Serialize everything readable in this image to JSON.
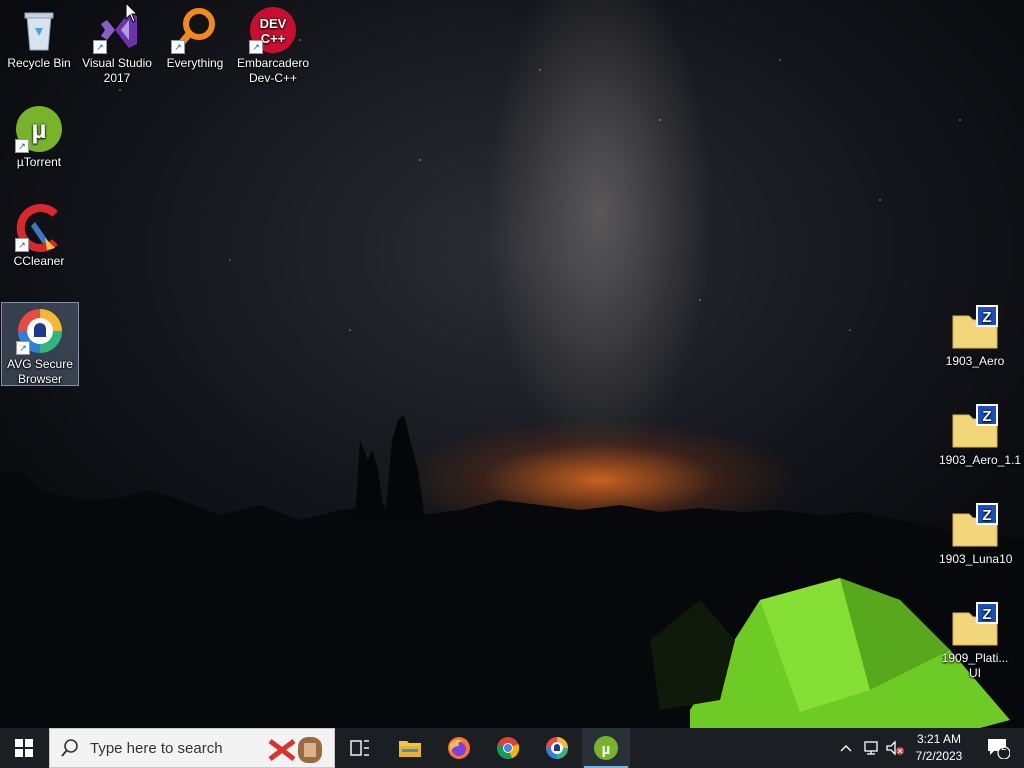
{
  "desktop": {
    "icons": [
      {
        "label": "Recycle Bin",
        "icon": "recycle-bin-icon"
      },
      {
        "label": "Visual Studio 2017",
        "icon": "visual-studio-icon"
      },
      {
        "label": "Everything",
        "icon": "everything-search-icon"
      },
      {
        "label": "Embarcadero Dev-C++",
        "icon": "dev-cpp-icon"
      },
      {
        "label": "µTorrent",
        "icon": "utorrent-icon"
      },
      {
        "label": "CCleaner",
        "icon": "ccleaner-icon"
      },
      {
        "label": "AVG Secure Browser",
        "icon": "avg-browser-icon",
        "selected": true
      },
      {
        "label": "1903_Aero",
        "icon": "zipped-folder-icon"
      },
      {
        "label": "1903_Aero_1.1",
        "icon": "zipped-folder-icon"
      },
      {
        "label": "1903_Luna10",
        "icon": "zipped-folder-icon"
      },
      {
        "label": "1909_Plati... UI",
        "icon": "zipped-folder-icon"
      }
    ],
    "dev_cpp_badge": "DEV\nC++",
    "zip_badge": "Z"
  },
  "taskbar": {
    "search_placeholder": "Type here to search",
    "pinned": [
      {
        "name": "task-view",
        "icon": "task-view-icon"
      },
      {
        "name": "file-explorer",
        "icon": "folder-icon"
      },
      {
        "name": "firefox",
        "icon": "firefox-icon"
      },
      {
        "name": "chrome",
        "icon": "chrome-icon"
      },
      {
        "name": "avg-browser",
        "icon": "avg-browser-icon"
      },
      {
        "name": "utorrent",
        "icon": "utorrent-icon",
        "active": true
      }
    ],
    "clock": {
      "time": "3:21 AM",
      "date": "7/2/2023"
    },
    "notification_count": "2"
  },
  "colors": {
    "taskbar": "#1b1f24",
    "accent": "#7ab3e6",
    "utorrent_green": "#78b32c"
  }
}
